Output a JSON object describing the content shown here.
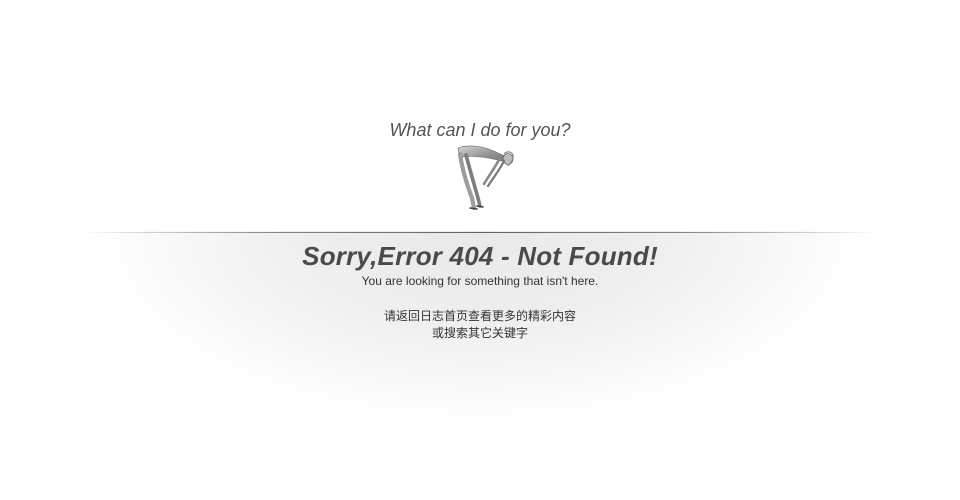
{
  "tagline": "What can I do for you?",
  "error": {
    "title": "Sorry,Error 404 - Not Found!",
    "subtitle": "You are looking for something that isn't here."
  },
  "hint": {
    "line1": "请返回日志首页查看更多的精彩内容",
    "line2": "或搜索其它关键字"
  },
  "colors": {
    "title": "#474a4f",
    "text": "#333333",
    "tagline": "#555555"
  },
  "illustration": "bending-figure-illustration"
}
